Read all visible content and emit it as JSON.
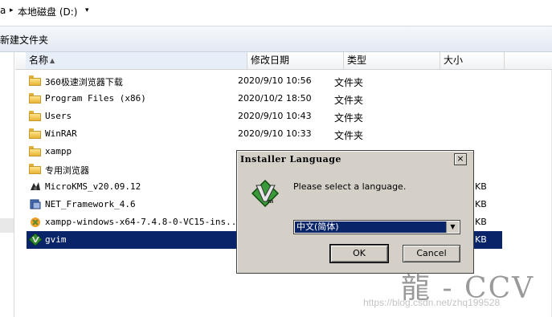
{
  "address_bar": {
    "seg1": "a",
    "seg2": "本地磁盘 (D:)"
  },
  "toolbar": {
    "new_folder": "新建文件夹"
  },
  "columns": {
    "name": "名称",
    "date": "修改日期",
    "type": "类型",
    "size": "大小"
  },
  "files": [
    {
      "name": "360极速浏览器下载",
      "date": "2020/9/10 10:56",
      "type": "文件夹",
      "size": "",
      "icon": "folder-icon"
    },
    {
      "name": "Program Files (x86)",
      "date": "2020/10/2 18:50",
      "type": "文件夹",
      "size": "",
      "icon": "folder-icon"
    },
    {
      "name": "Users",
      "date": "2020/9/10 10:43",
      "type": "文件夹",
      "size": "",
      "icon": "folder-icon"
    },
    {
      "name": "WinRAR",
      "date": "2020/9/10 10:33",
      "type": "文件夹",
      "size": "",
      "icon": "folder-icon"
    },
    {
      "name": "xampp",
      "date": "",
      "type": "",
      "size": "",
      "icon": "folder-icon"
    },
    {
      "name": "专用浏览器",
      "date": "",
      "type": "",
      "size": "",
      "icon": "folder-icon"
    },
    {
      "name": "MicroKMS_v20.09.12",
      "date": "",
      "type": "",
      "size": "KB",
      "icon": "kms-icon"
    },
    {
      "name": "NET_Framework_4.6",
      "date": "",
      "type": "",
      "size": "KB",
      "icon": "installer-icon"
    },
    {
      "name": "xampp-windows-x64-7.4.8-0-VC15-ins...",
      "date": "",
      "type": "",
      "size": "KB",
      "icon": "xampp-icon"
    },
    {
      "name": "gvim",
      "date": "",
      "type": "",
      "size": "KB",
      "icon": "vim-icon"
    }
  ],
  "dialog": {
    "title": "Installer Language",
    "close": "×",
    "prompt": "Please select a language.",
    "selected_language": "中文(简体)",
    "ok": "OK",
    "cancel": "Cancel"
  },
  "watermark": {
    "logo": "龍 - CCV",
    "url": "https://blog.csdn.net/zhq199528"
  },
  "colors": {
    "selection": "#0a246a",
    "dialog_bg": "#d4d0c8"
  }
}
